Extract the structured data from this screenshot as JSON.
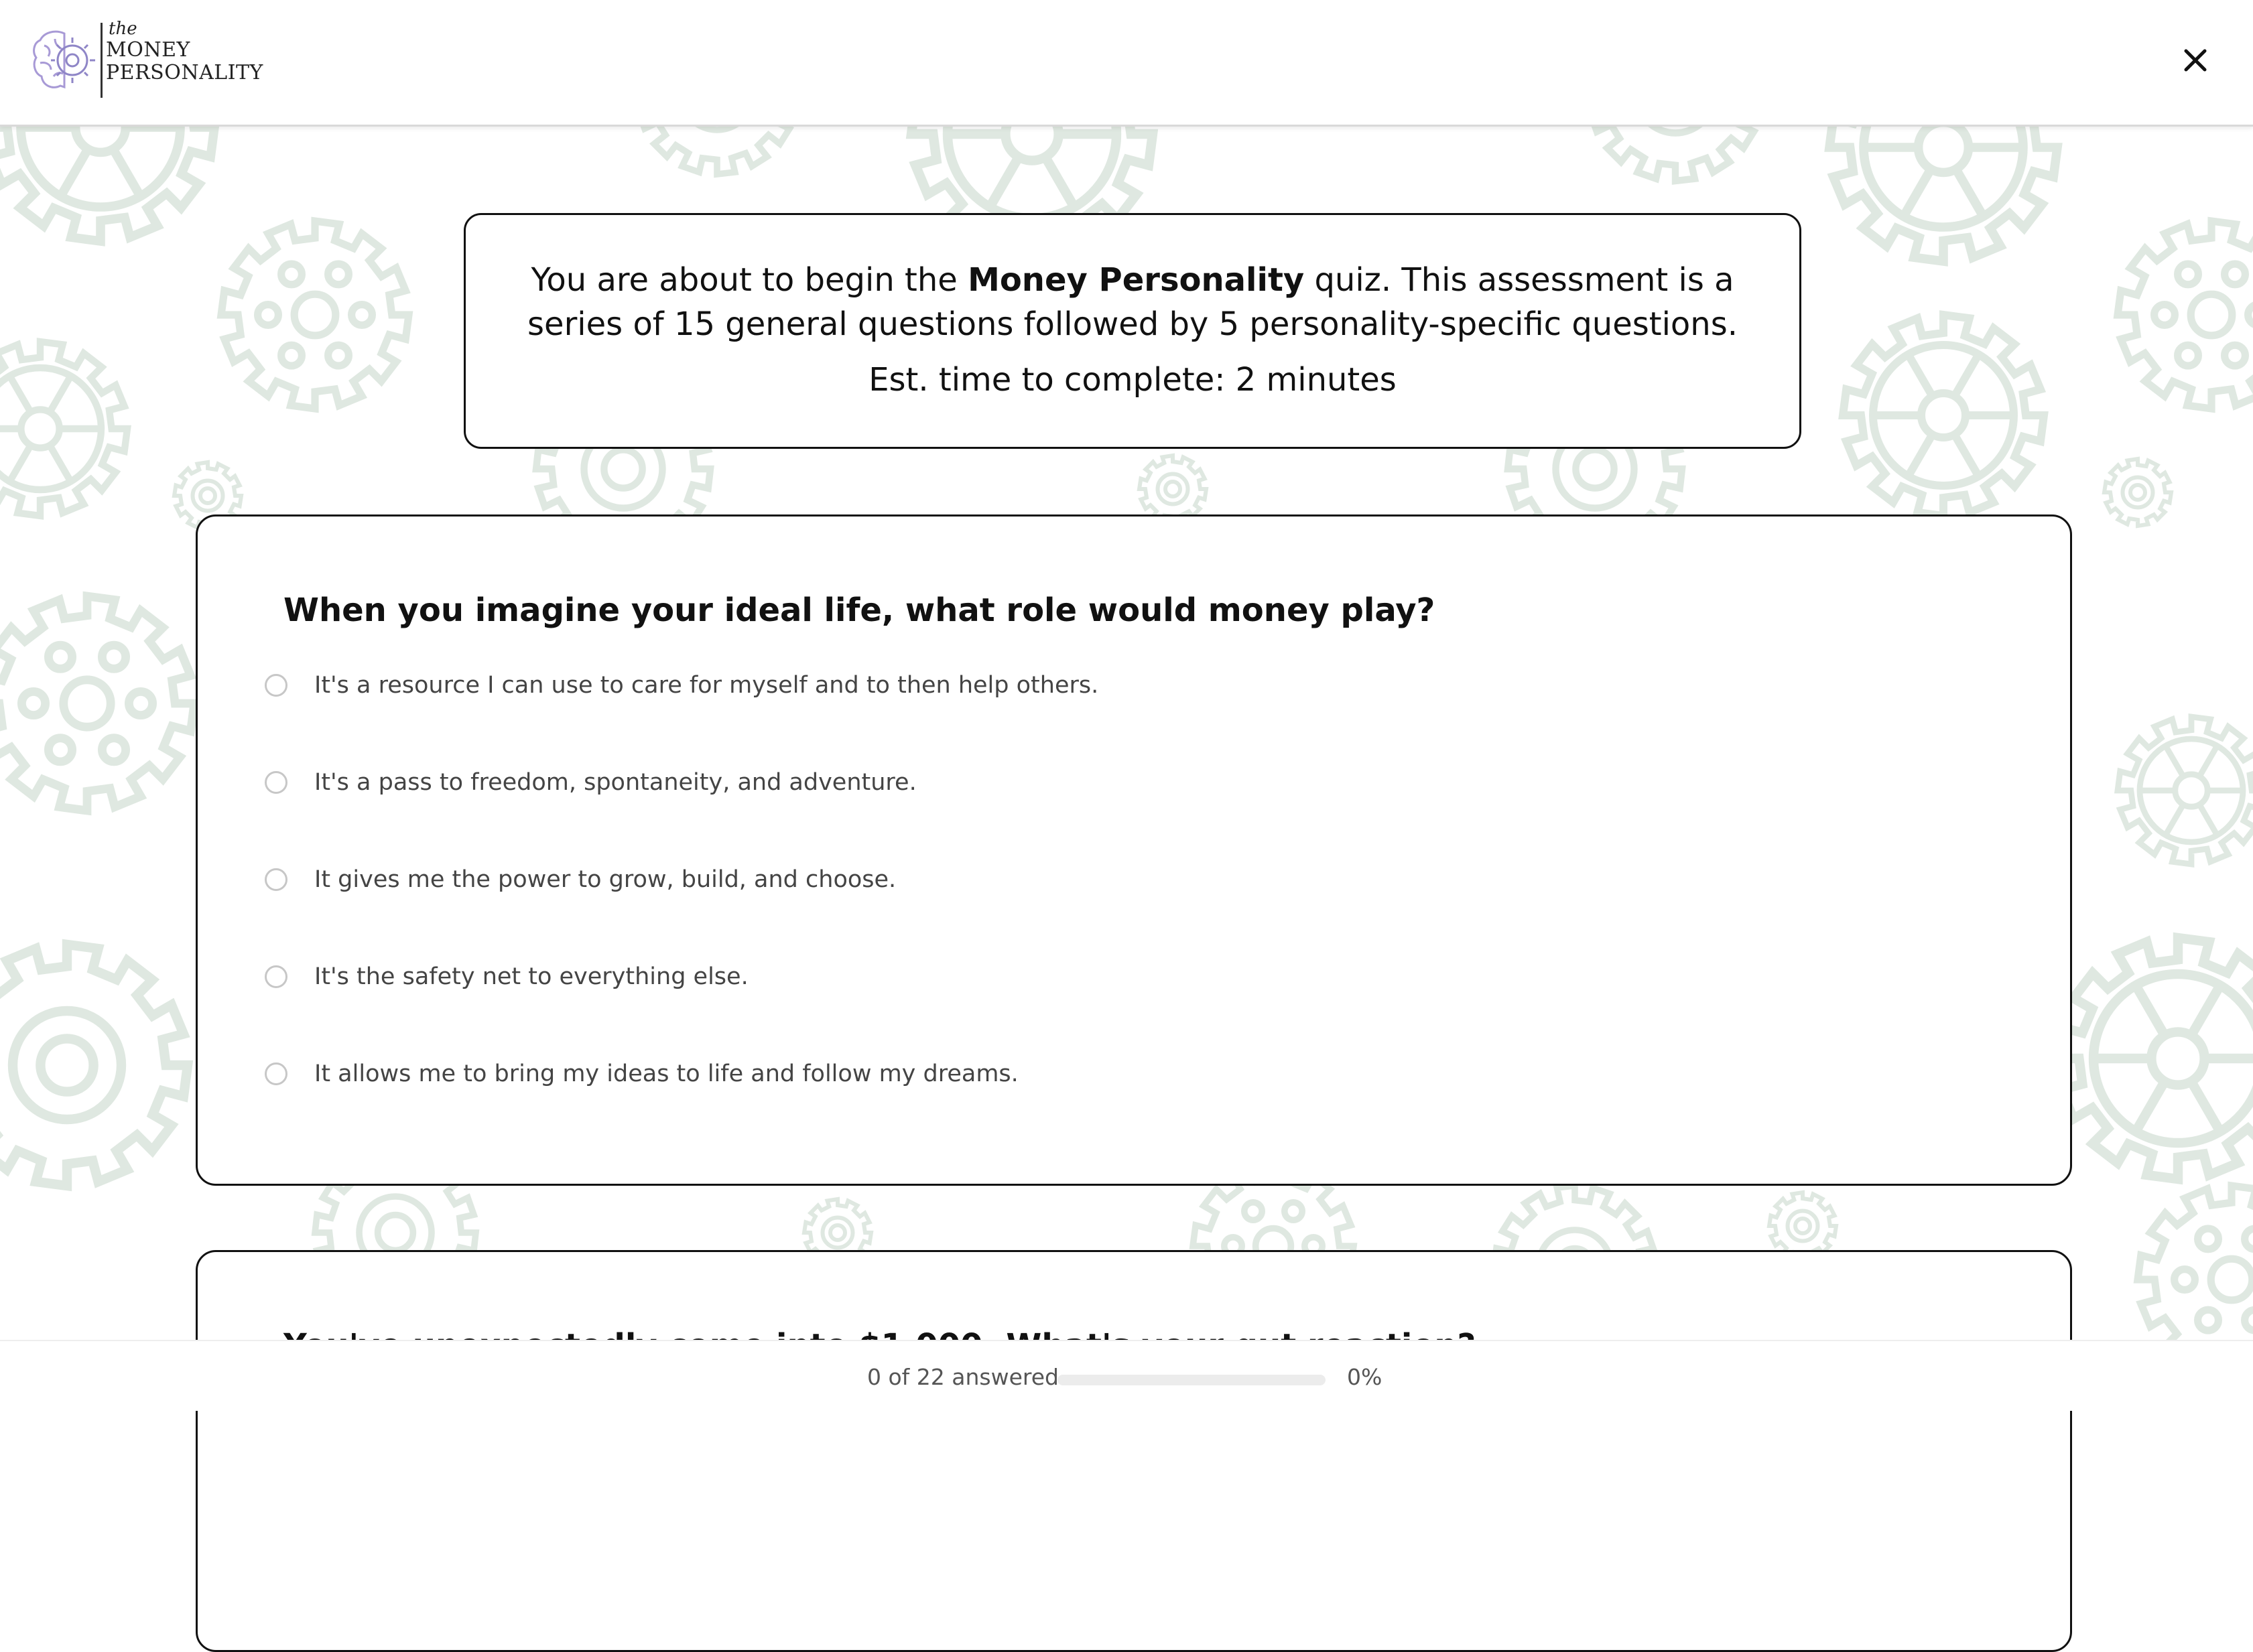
{
  "brand": {
    "logo_the": "the",
    "logo_line1": "MONEY",
    "logo_line2": "PERSONALITY"
  },
  "header": {
    "close_icon": "close-icon"
  },
  "intro": {
    "text_before": "You are about to begin the ",
    "text_bold": "Money Personality",
    "text_after": " quiz. This assessment is a series of 15 general questions followed by 5 personality-specific questions.",
    "time": "Est. time to complete: 2 minutes"
  },
  "questions": [
    {
      "title": "When you imagine your ideal life, what role would money play?",
      "options": [
        "It's a resource I can use to care for myself and to then help others.",
        "It's a pass to freedom, spontaneity, and adventure.",
        "It gives me the power to grow, build, and choose.",
        "It's the safety net to everything else.",
        "It allows me to bring my ideas to life and follow my dreams."
      ]
    },
    {
      "title": "You've unexpectedly come into $1,000. What's your gut reaction?"
    }
  ],
  "progress": {
    "answered_text": "0 of 22 answered",
    "percent_text": "0%",
    "fraction": 0
  },
  "colors": {
    "gear": "#dfe8e1",
    "border": "#111111",
    "logo_purple": "#a89ad6",
    "progress_track": "#ececec"
  }
}
